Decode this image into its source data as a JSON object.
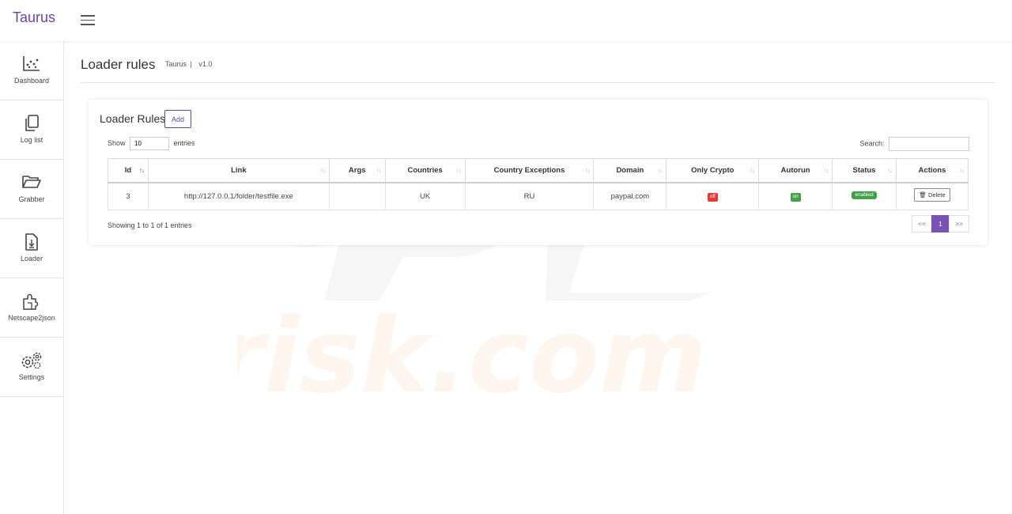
{
  "app": {
    "brand": "Taurus"
  },
  "sidebar": {
    "items": [
      {
        "label": "Dashboard",
        "icon": "chart-icon"
      },
      {
        "label": "Log list",
        "icon": "copy-icon"
      },
      {
        "label": "Grabber",
        "icon": "folder-icon"
      },
      {
        "label": "Loader",
        "icon": "file-download-icon"
      },
      {
        "label": "Netscape2json",
        "icon": "puzzle-icon"
      },
      {
        "label": "Settings",
        "icon": "gears-icon"
      }
    ]
  },
  "page": {
    "title": "Loader rules",
    "crumb_app": "Taurus",
    "crumb_sep": "|",
    "version": "v1.0"
  },
  "card": {
    "title": "Loader Rules",
    "add_label": "Add",
    "show_label": "Show",
    "show_value": "10",
    "entries_label": "entries",
    "search_label": "Search:",
    "search_value": ""
  },
  "table": {
    "columns": [
      "Id",
      "Link",
      "Args",
      "Countries",
      "Country Exceptions",
      "Domain",
      "Only Crypto",
      "Autorun",
      "Status",
      "Actions"
    ],
    "sort_indicator": "↑↓",
    "rows": [
      {
        "id": "3",
        "link": "http://127.0.0.1/folder/testfile.exe",
        "args": "",
        "countries": "UK",
        "exceptions": "RU",
        "domain": "paypal.com",
        "only_crypto": "off",
        "autorun": "on",
        "status": "enabled",
        "action": "Delete"
      }
    ]
  },
  "footer": {
    "info": "Showing 1 to 1 of 1 entries",
    "prev": "<<",
    "page": "1",
    "next": ">>"
  },
  "colors": {
    "brand": "#6f42a1",
    "accent": "#7952b3",
    "off": "#e53935",
    "on": "#43a047"
  }
}
